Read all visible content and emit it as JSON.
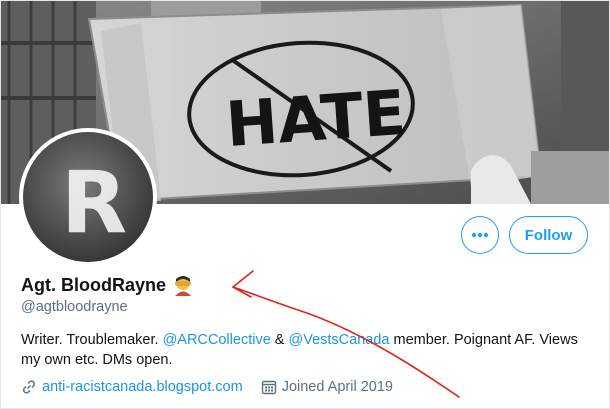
{
  "profile": {
    "display_name": "Agt. BloodRayne",
    "handle": "@agtbloodrayne",
    "bio_parts": {
      "p1": "Writer. Troublemaker. ",
      "mention1": "@ARCCollective",
      "p2": " & ",
      "mention2": "@VestsCanada",
      "p3": " member. Poignant AF. Views my own etc. DMs open."
    },
    "website": "anti-racistcanada.blogspot.com",
    "joined": "Joined April 2019",
    "name_emoji": "see-no-evil-person-emoji"
  },
  "banner": {
    "sign_text": "HATE",
    "description_icon": "no-hate-sign"
  },
  "avatar": {
    "letter": "R"
  },
  "actions": {
    "follow_label": "Follow",
    "more_icon": "ellipsis-icon"
  },
  "colors": {
    "accent": "#1da1f2",
    "link": "#1b95e0",
    "muted": "#5b7083",
    "annotation": "#e0231c"
  }
}
